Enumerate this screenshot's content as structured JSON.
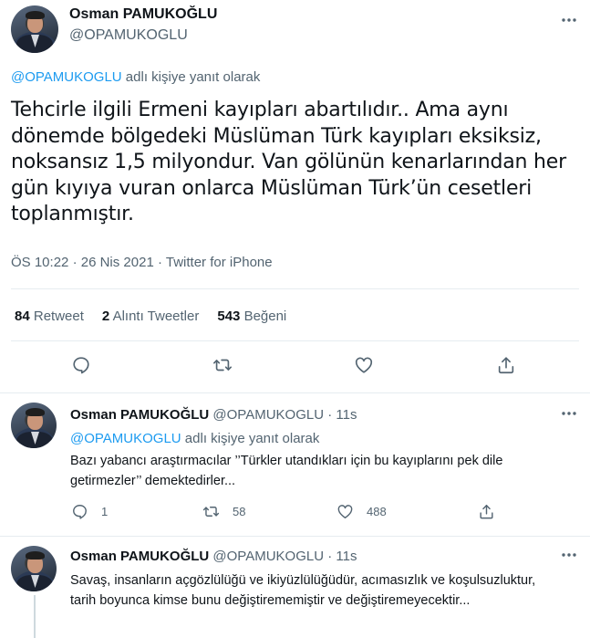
{
  "main_tweet": {
    "author_name": "Osman PAMUKOĞLU",
    "author_handle": "@OPAMUKOGLU",
    "reply_mention": "@OPAMUKOGLU",
    "reply_suffix": " adlı kişiye yanıt olarak",
    "text": "Tehcirle ilgili Ermeni kayıpları abartılıdır.. Ama aynı dönemde bölgedeki Müslüman Türk kayıpları eksiksiz, noksansız 1,5 milyondur. Van gölünün kenarlarından her gün kıyıya vuran onlarca Müslüman Türk’ün cesetleri toplanmıştır.",
    "time": "ÖS 10:22",
    "date": "26 Nis 2021",
    "client": "Twitter for iPhone",
    "retweets": "84",
    "retweets_label": "Retweet",
    "quotes": "2",
    "quotes_label": "Alıntı Tweetler",
    "likes": "543",
    "likes_label": "Beğeni"
  },
  "replies": [
    {
      "author_name": "Osman PAMUKOĞLU",
      "author_handle": "@OPAMUKOGLU",
      "time": "11s",
      "reply_mention": "@OPAMUKOGLU",
      "reply_suffix": " adlı kişiye yanıt olarak",
      "text": "Bazı yabancı araştırmacılar ’’Türkler utandıkları için bu kayıplarını pek dile getirmezler’’ demektedirler...",
      "replies": "1",
      "retweets": "58",
      "likes": "488"
    },
    {
      "author_name": "Osman PAMUKOĞLU",
      "author_handle": "@OPAMUKOGLU",
      "time": "11s",
      "text": "Savaş, insanların açgözlülüğü ve ikiyüzlülüğüdür, acımasızlık ve koşulsuzluktur, tarih boyunca kimse bunu değiştirememiştir ve değiştiremeyecektir..."
    }
  ],
  "icons": {
    "more": "more-horizontal-icon",
    "reply": "reply-bubble-icon",
    "retweet": "retweet-icon",
    "like": "heart-icon",
    "share": "share-upload-icon"
  },
  "colors": {
    "accent": "#1d9bf0",
    "secondary_text": "#536471",
    "divider": "#e6ecf0"
  }
}
